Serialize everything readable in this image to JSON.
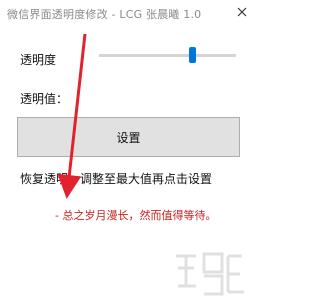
{
  "window": {
    "title": "微信界面透明度修改 - LCG 张晨曦 1.0"
  },
  "controls": {
    "opacity_label": "透明度",
    "value_label": "透明值：",
    "slider_level": 0.68,
    "set_button_label": "设置"
  },
  "hint": {
    "restore_text": "恢复透明：调整至最大值再点击设置",
    "quote_text": "- 总之岁月漫长，然而值得等待。"
  },
  "annotation": {
    "arrow_color": "#e0232c"
  },
  "colors": {
    "accent": "#0078d7",
    "quote": "#cc1f1f"
  },
  "icons": {
    "close": "close-icon",
    "arrow": "red-arrow-annotation"
  }
}
